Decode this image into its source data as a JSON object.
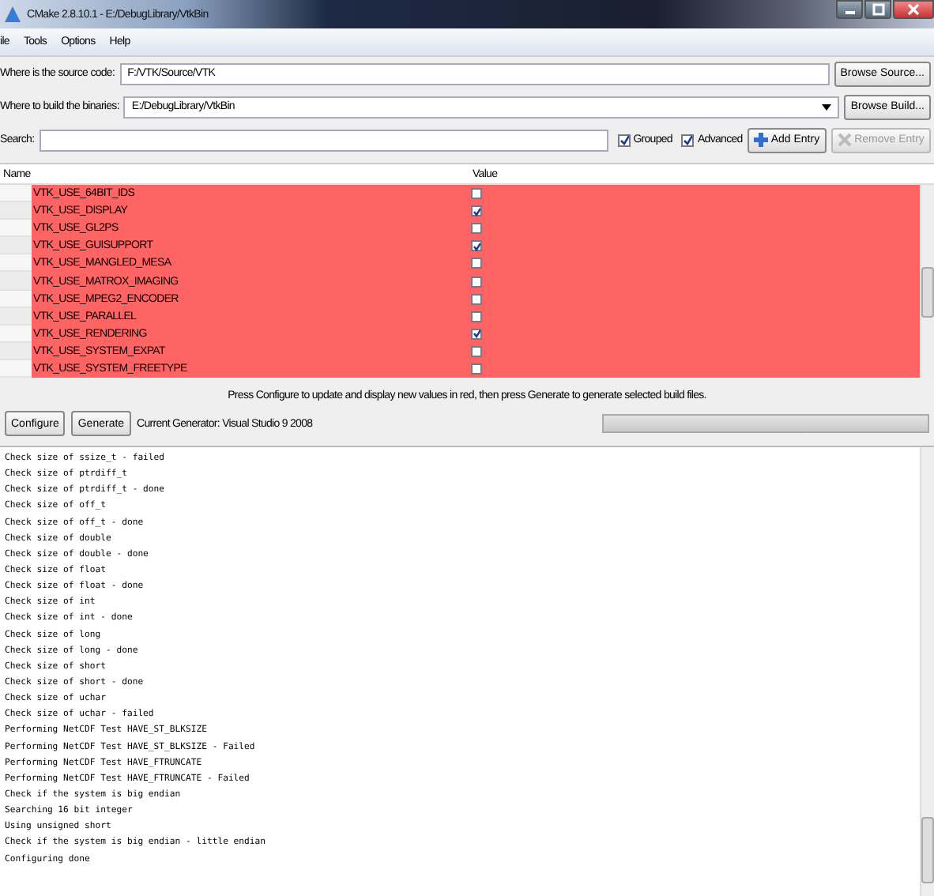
{
  "window": {
    "title": "CMake 2.8.10.1 - E:/DebugLibrary/VtkBin"
  },
  "menu": [
    "ile",
    "Tools",
    "Options",
    "Help"
  ],
  "source": {
    "label": "Where is the source code:",
    "value": "F:/VTK/Source/VTK",
    "button": "Browse Source..."
  },
  "build": {
    "label": "Where to build the binaries:",
    "value": "E:/DebugLibrary/VtkBin",
    "button": "Browse Build..."
  },
  "search": {
    "label": "Search:"
  },
  "options": [
    {
      "label": "Grouped",
      "checked": true
    },
    {
      "label": "Advanced",
      "checked": true
    }
  ],
  "add_entry": {
    "label": "Add Entry",
    "disabled": false
  },
  "remove_entry": {
    "label": "Remove Entry",
    "disabled": true
  },
  "table": {
    "columns": [
      "Name",
      "Value"
    ],
    "rows": [
      {
        "name": "VTK_USE_64BIT_IDS",
        "checked": false
      },
      {
        "name": "VTK_USE_DISPLAY",
        "checked": true
      },
      {
        "name": "VTK_USE_GL2PS",
        "checked": false
      },
      {
        "name": "VTK_USE_GUISUPPORT",
        "checked": true
      },
      {
        "name": "VTK_USE_MANGLED_MESA",
        "checked": false
      },
      {
        "name": "VTK_USE_MATROX_IMAGING",
        "checked": false
      },
      {
        "name": "VTK_USE_MPEG2_ENCODER",
        "checked": false
      },
      {
        "name": "VTK_USE_PARALLEL",
        "checked": false
      },
      {
        "name": "VTK_USE_RENDERING",
        "checked": true
      },
      {
        "name": "VTK_USE_SYSTEM_EXPAT",
        "checked": false
      },
      {
        "name": "VTK_USE_SYSTEM_FREETYPE",
        "checked": false
      }
    ]
  },
  "message": "Press Configure to update and display new values in red, then press Generate to generate selected build files.",
  "buttons": [
    "Configure",
    "Generate"
  ],
  "generator": "Current Generator: Visual Studio 9 2008",
  "progress": {
    "level": 0
  },
  "output": [
    "Check size of ssize_t - failed",
    "Check size of ptrdiff_t",
    "Check size of ptrdiff_t - done",
    "Check size of off_t",
    "Check size of off_t - done",
    "Check size of double",
    "Check size of double - done",
    "Check size of float",
    "Check size of float - done",
    "Check size of int",
    "Check size of int - done",
    "Check size of long",
    "Check size of long - done",
    "Check size of short",
    "Check size of short - done",
    "Check size of uchar",
    "Check size of uchar - failed",
    "Performing NetCDF Test HAVE_ST_BLKSIZE",
    "Performing NetCDF Test HAVE_ST_BLKSIZE - Failed",
    "Performing NetCDF Test HAVE_FTRUNCATE",
    "Performing NetCDF Test HAVE_FTRUNCATE - Failed",
    "Check if the system is big endian",
    "Searching 16 bit integer",
    "Using unsigned short",
    "Check if the system is big endian - little endian",
    "Configuring done"
  ]
}
